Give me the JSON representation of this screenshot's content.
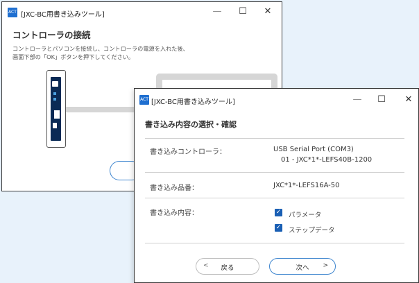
{
  "window1": {
    "icon_text": "ACT",
    "title": "[JXC-BC用書き込みツール]",
    "controls": {
      "minimize": "—",
      "maximize": "☐",
      "close": "✕"
    },
    "heading": "コントローラの接続",
    "description": [
      "コントローラとパソコンを接続し、コントローラの電源を入れた後、",
      "画面下部の「OK」ボタンを押下してください。"
    ]
  },
  "window2": {
    "icon_text": "ACT",
    "title": "[JXC-BC用書き込みツール]",
    "controls": {
      "minimize": "—",
      "maximize": "☐",
      "close": "✕"
    },
    "heading": "書き込み内容の選択・確認",
    "rows": {
      "controller_label": "書き込みコントローラ：",
      "controller_port": "USB Serial Port (COM3)",
      "controller_model": "01 - JXC*1*-LEFS40B-1200",
      "product_label": "書き込み品番：",
      "product_value": "JXC*1*-LEFS16A-50",
      "content_label": "書き込み内容：",
      "options": [
        {
          "label": "パラメータ",
          "checked": true
        },
        {
          "label": "ステップデータ",
          "checked": true
        }
      ]
    },
    "buttons": {
      "back_label": "戻る",
      "back_arrow": "<",
      "next_label": "次へ",
      "next_arrow": ">"
    }
  }
}
